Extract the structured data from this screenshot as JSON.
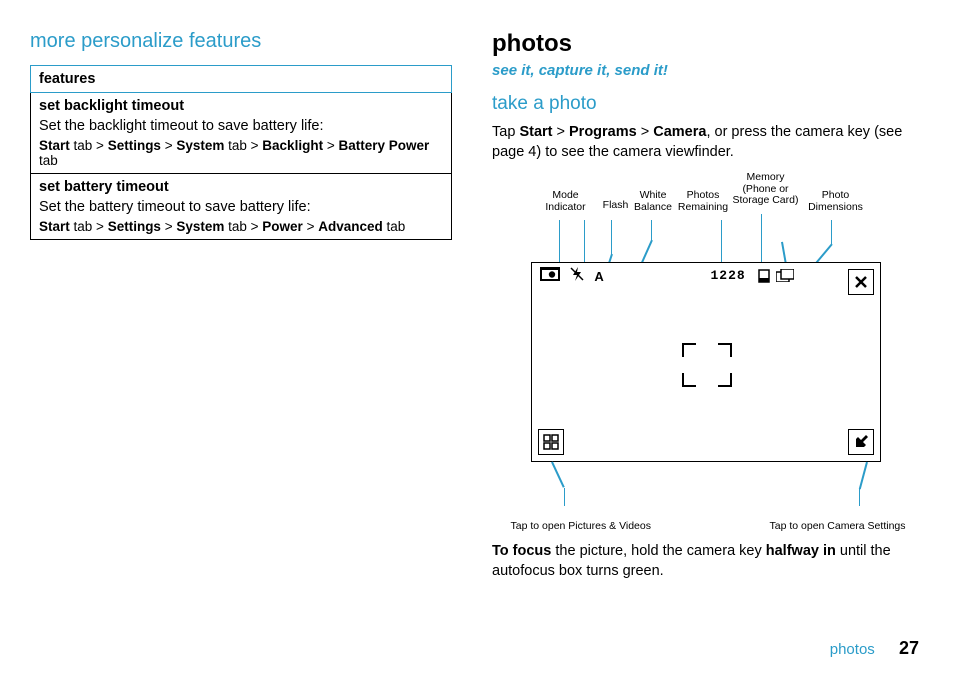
{
  "left": {
    "heading": "more personalize features",
    "table_header": "features",
    "row1_title": "set backlight timeout",
    "row1_body": "Set the backlight timeout to save battery life:",
    "row1_path_parts": {
      "a": "Start",
      "b": "Settings",
      "c": "System",
      "d": "Backlight",
      "e": "Battery Power"
    },
    "row1_tab": " tab ",
    "row1_tab_end": " tab",
    "row2_title": "set battery timeout",
    "row2_body": "Set the battery timeout to save battery life:",
    "row2_path_parts": {
      "a": "Start",
      "b": "Settings",
      "c": "System",
      "d": "Power",
      "e": "Advanced"
    }
  },
  "right": {
    "title": "photos",
    "subtitle": "see it, capture it, send it!",
    "subsection": "take a photo",
    "intro_pre": "Tap ",
    "intro_start": "Start",
    "intro_gt": " > ",
    "intro_programs": "Programs",
    "intro_camera": "Camera",
    "intro_post": ", or press the camera key (see page 4) to see the camera viewfinder.",
    "focus_pre": "To focus",
    "focus_mid": " the picture, hold the camera key ",
    "focus_half": "halfway in",
    "focus_post": " until the autofocus box turns green."
  },
  "diagram": {
    "labels": {
      "mode": "Mode Indicator",
      "flash": "Flash",
      "wb": "White Balance",
      "remaining": "Photos Remaining",
      "memory": "Memory (Phone or Storage Card)",
      "dims": "Photo Dimensions"
    },
    "counter": "1228",
    "wb_letter": "A",
    "bottom_left": "Tap to open Pictures & Videos",
    "bottom_right": "Tap to open Camera Settings"
  },
  "footer": {
    "label": "photos",
    "page": "27"
  },
  "gt": " >"
}
